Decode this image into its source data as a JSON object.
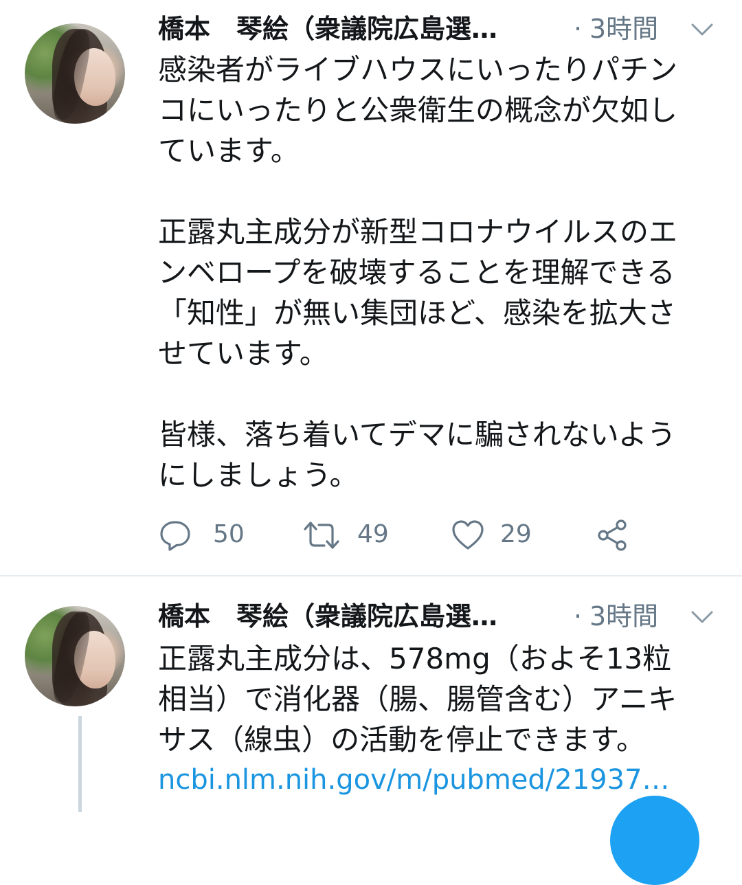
{
  "tweets": [
    {
      "author": "橋本　琴絵（衆議院広島選…",
      "separator": "·",
      "time": "3時間",
      "text": "感染者がライブハウスにいったりパチン\nコにいったりと公衆衛生の概念が欠如し\nています。\n\n正露丸主成分が新型コロナウイルスのエ\nンベロープを破壊することを理解できる\n「知性」が無い集団ほど、感染を拡大さ\nせています。\n\n皆様、落ち着いてデマに騙されないよう\nにしましょう。",
      "stats": {
        "replies": "50",
        "retweets": "49",
        "likes": "29"
      }
    },
    {
      "author": "橋本　琴絵（衆議院広島選…",
      "separator": "·",
      "time": "3時間",
      "text": "正露丸主成分は、578mg（およそ13粒\n相当）で消化器（腸、腸管含む）アニキ\nサス（線虫）の活動を停止できます。",
      "link": "ncbi.nlm.nih.gov/m/pubmed/21937…"
    }
  ],
  "icons": {
    "reply": "reply-icon",
    "retweet": "retweet-icon",
    "like": "heart-icon",
    "share": "share-icon",
    "menu": "chevron-down-icon"
  },
  "colors": {
    "text": "#14171a",
    "secondary": "#657786",
    "link": "#1b95e0",
    "divider": "#e6ecf0",
    "fab": "#1da1f2"
  }
}
